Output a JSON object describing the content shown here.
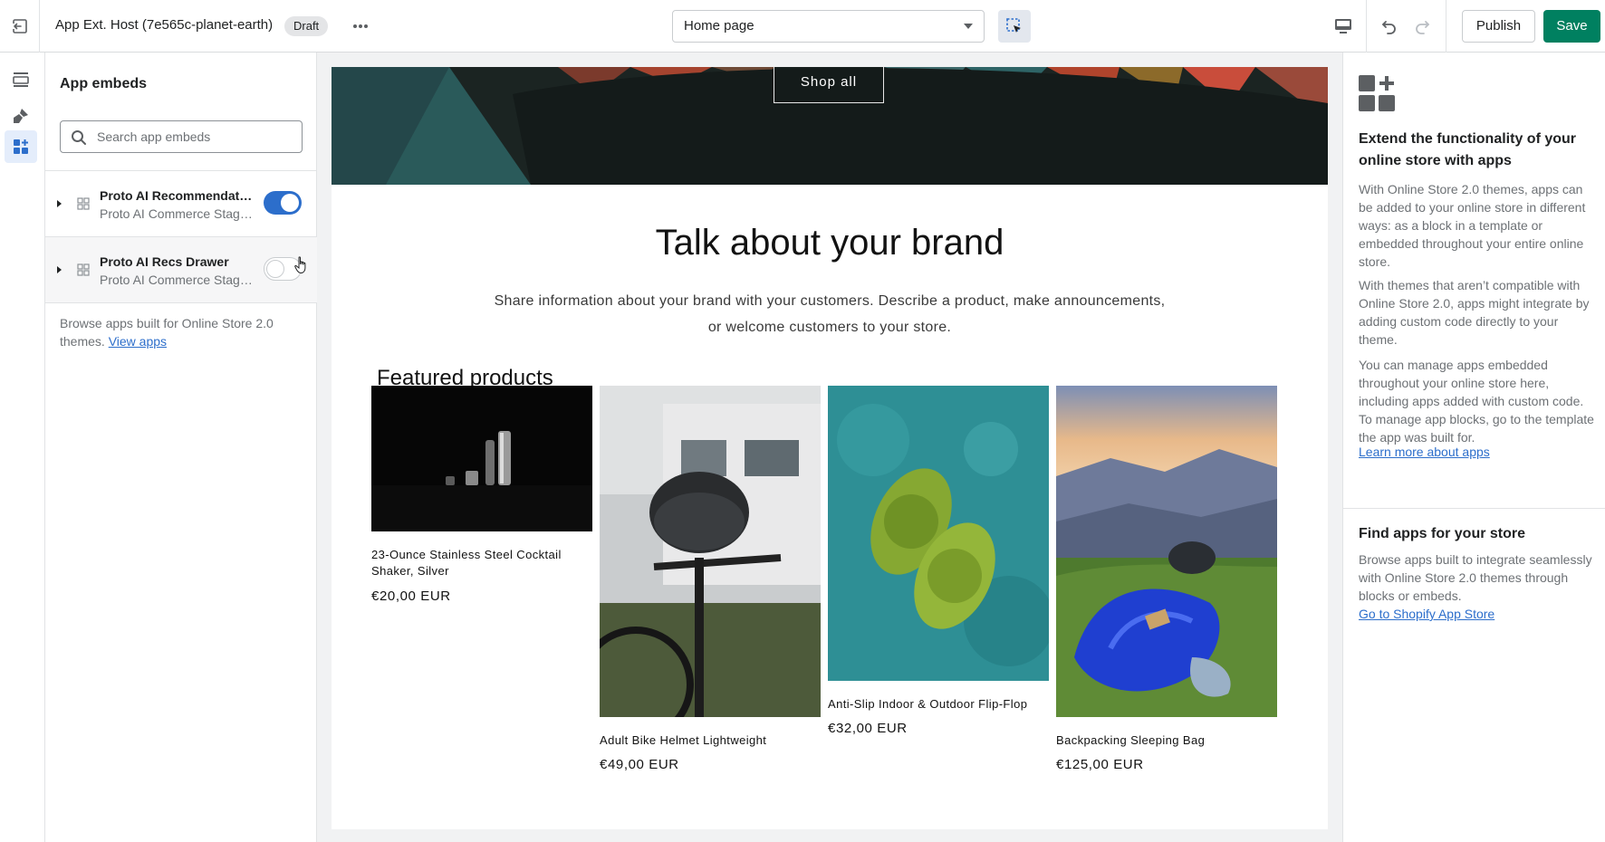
{
  "topbar": {
    "app_title": "App Ext. Host (7e565c-planet-earth)",
    "status_badge": "Draft",
    "page_select": "Home page",
    "publish_label": "Publish",
    "save_label": "Save"
  },
  "rail": {
    "items": [
      {
        "icon": "sections-icon"
      },
      {
        "icon": "theme-brush-icon"
      },
      {
        "icon": "app-embeds-icon",
        "active": true
      }
    ]
  },
  "left_panel": {
    "title": "App embeds",
    "search_placeholder": "Search app embeds",
    "embeds": [
      {
        "name": "Proto AI Recommendations",
        "subtitle": "Proto AI Commerce Staging",
        "enabled": true
      },
      {
        "name": "Proto AI Recs Drawer",
        "subtitle": "Proto AI Commerce Staging",
        "enabled": false
      }
    ],
    "browse_text": "Browse apps built for Online Store 2.0 themes.",
    "browse_link": "View apps"
  },
  "preview": {
    "hero_button": "Shop all",
    "brand_heading": "Talk about your brand",
    "brand_text": "Share information about your brand with your customers. Describe a product, make announcements, or welcome customers to your store.",
    "featured_heading": "Featured products",
    "products": [
      {
        "title": "23-Ounce Stainless Steel Cocktail Shaker, Silver",
        "price": "€20,00 EUR"
      },
      {
        "title": "Adult Bike Helmet Lightweight",
        "price": "€49,00 EUR"
      },
      {
        "title": "Anti-Slip Indoor & Outdoor Flip-Flop",
        "price": "€32,00 EUR"
      },
      {
        "title": "Backpacking Sleeping Bag",
        "price": "€125,00 EUR"
      }
    ]
  },
  "right_panel": {
    "heading": "Extend the functionality of your online store with apps",
    "para1": "With Online Store 2.0 themes, apps can be added to your online store in different ways: as a block in a template or embedded throughout your entire online store.",
    "para2": "With themes that aren’t compatible with Online Store 2.0, apps might integrate by adding custom code directly to your theme.",
    "para3": "You can manage apps embedded throughout your online store here, including apps added with custom code. To manage app blocks, go to the template the app was built for.",
    "learn_link": "Learn more about apps",
    "find_heading": "Find apps for your store",
    "find_text": "Browse apps built to integrate seamlessly with Online Store 2.0 themes through blocks or embeds.",
    "store_link": "Go to Shopify App Store"
  },
  "colors": {
    "accent_blue": "#2c6ecb",
    "save_green": "#008060",
    "hero_dark": "#1b2422"
  }
}
